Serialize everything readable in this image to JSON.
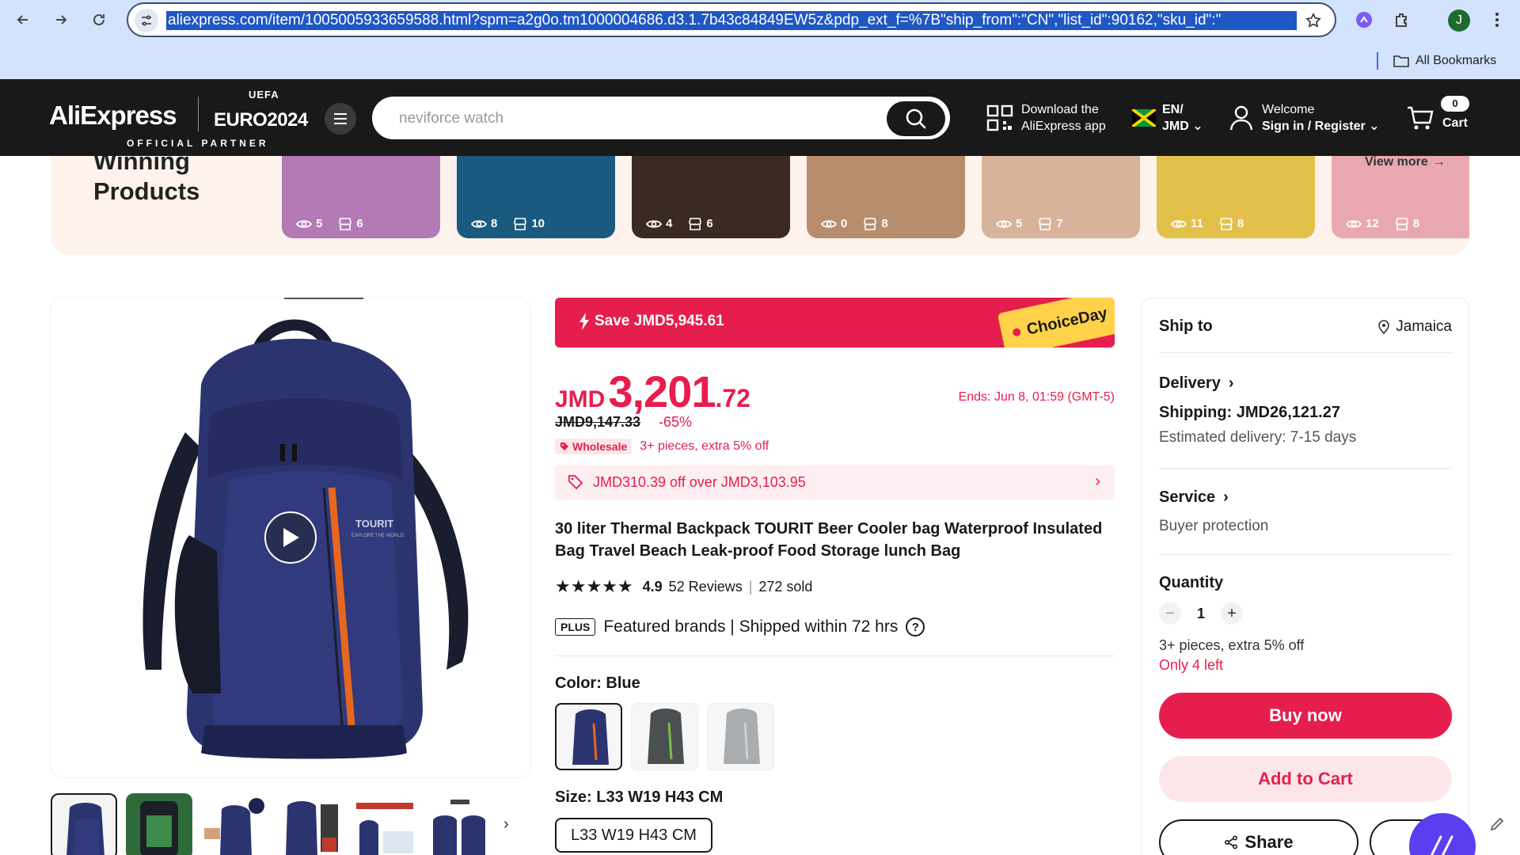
{
  "browser": {
    "url": "aliexpress.com/item/1005005933659588.html?spm=a2g0o.tm1000004686.d3.1.7b43c84849EW5z&pdp_ext_f=%7B\"ship_from\":\"CN\",\"list_id\":90162,\"sku_id\":\"",
    "profile_initial": "J",
    "all_bookmarks": "All Bookmarks"
  },
  "header": {
    "logo": "AliExpress",
    "euro_uefa": "UEFA",
    "euro_text": "EURO2024",
    "official_partner": "OFFICIAL PARTNER",
    "search_placeholder": "neviforce watch",
    "download_line1": "Download the",
    "download_line2": "AliExpress app",
    "lang_line1": "EN/",
    "lang_line2": "JMD",
    "welcome_line1": "Welcome",
    "welcome_line2": "Sign in / Register",
    "cart_count": "0",
    "cart_label": "Cart"
  },
  "winning": {
    "title_line1": "Winning",
    "title_line2": "Products",
    "view_more": "View more",
    "cards": [
      {
        "views": "5",
        "stores": "6",
        "color": "#b37ab5"
      },
      {
        "views": "8",
        "stores": "10",
        "color": "#1a5a80"
      },
      {
        "views": "4",
        "stores": "6",
        "color": "#3a2a22"
      },
      {
        "views": "0",
        "stores": "8",
        "color": "#b88d6c"
      },
      {
        "views": "5",
        "stores": "7",
        "color": "#d6b39a"
      },
      {
        "views": "11",
        "stores": "8",
        "color": "#e3c04a"
      },
      {
        "views": "12",
        "stores": "8",
        "color": "#e9a8b0"
      }
    ]
  },
  "product": {
    "save_text": "Save JMD5,945.61",
    "choice_day": "ChoiceDay",
    "price_currency": "JMD",
    "price_main": "3,201",
    "price_decimal": ".72",
    "ends": "Ends: Jun 8, 01:59 (GMT-5)",
    "old_price": "JMD9,147.33",
    "discount": "-65%",
    "wholesale_badge": "Wholesale",
    "wholesale_text": "3+ pieces, extra 5% off",
    "coupon": "JMD310.39 off over JMD3,103.95",
    "title": "30 liter Thermal Backpack TOURIT Beer Cooler bag Waterproof Insulated Bag Travel Beach Leak-proof Food Storage lunch Bag",
    "rating": "4.9",
    "reviews": "52 Reviews",
    "sold": "272 sold",
    "plus_badge": "PLUS",
    "plus_text": "Featured brands | Shipped within 72 hrs",
    "color_label": "Color: Blue",
    "size_label": "Size: L33 W19 H43 CM",
    "size_option": "L33 W19 H43 CM",
    "swatch_colors": [
      "#2e3a7a",
      "#4a4f52",
      "#a9adaf"
    ],
    "brand_print": "TOURIT",
    "brand_tagline": "EXPLORE THE WORLD"
  },
  "side": {
    "ship_to_label": "Ship to",
    "ship_to_value": "Jamaica",
    "delivery_label": "Delivery",
    "shipping": "Shipping: JMD26,121.27",
    "estimated": "Estimated delivery: 7-15 days",
    "service_label": "Service",
    "service_value": "Buyer protection",
    "quantity_label": "Quantity",
    "quantity_value": "1",
    "qty_note": "3+ pieces, extra 5% off",
    "stock_note": "Only 4 left",
    "buy_now": "Buy now",
    "add_to_cart": "Add to Cart",
    "share": "Share"
  },
  "colors": {
    "brand_red": "#e61e4d",
    "header_black": "#191919",
    "chrome_blue": "#d3e3fd"
  }
}
